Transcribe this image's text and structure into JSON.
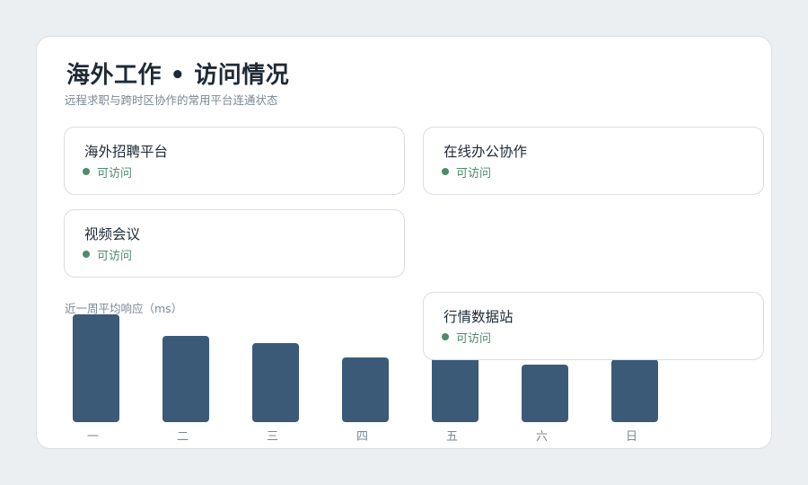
{
  "header": {
    "title": "海外工作 • 访问情况",
    "subtitle": "远程求职与跨时区协作的常用平台连通状态"
  },
  "cards": [
    {
      "name": "海外招聘平台",
      "status": "可访问"
    },
    {
      "name": "在线办公协作",
      "status": "可访问"
    },
    {
      "name": "视频会议",
      "status": "可访问"
    },
    {
      "name": "行情数据站",
      "status": "可访问"
    }
  ],
  "colors": {
    "status_ok": "#4e8a6e",
    "bar": "#3b5a78",
    "background": "#eceff2"
  },
  "chart": {
    "label": "近一周平均响应（ms）"
  },
  "chart_data": {
    "type": "bar",
    "categories": [
      "一",
      "二",
      "三",
      "四",
      "五",
      "六",
      "日"
    ],
    "values": [
      120,
      96,
      88,
      72,
      80,
      64,
      70
    ],
    "ylim": [
      0,
      120
    ],
    "grid": false
  }
}
